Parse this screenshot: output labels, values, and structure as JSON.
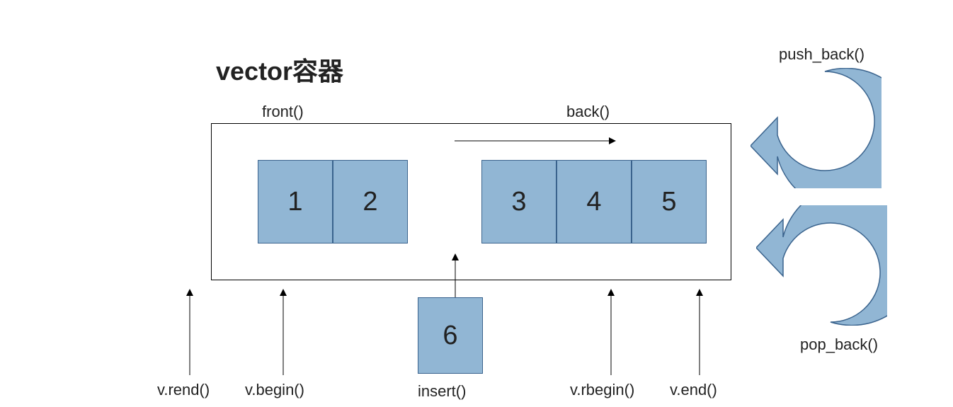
{
  "title": "vector容器",
  "labels": {
    "front": "front()",
    "back": "back()",
    "push_back": "push_back()",
    "pop_back": "pop_back()",
    "insert": "insert()"
  },
  "iterators": {
    "rend": "v.rend()",
    "begin": "v.begin()",
    "rbegin": "v.rbegin()",
    "end": "v.end()"
  },
  "cells": {
    "c1": "1",
    "c2": "2",
    "c3": "3",
    "c4": "4",
    "c5": "5",
    "c6": "6"
  },
  "colors": {
    "box_fill": "#91b6d4",
    "box_stroke": "#3a638d"
  }
}
